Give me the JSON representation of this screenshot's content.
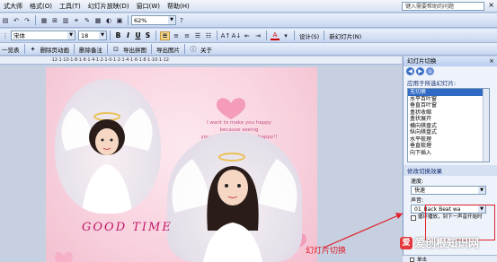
{
  "menubar": {
    "items": [
      "式大师",
      "格式(O)",
      "工具(T)",
      "幻灯片放映(D)",
      "窗口(W)",
      "帮助(H)"
    ],
    "help_placeholder": "键入需要帮助的问题"
  },
  "toolbar1": {
    "zoom_value": "62%"
  },
  "toolbar2": {
    "font_name": "宋体",
    "font_size": "18",
    "bold": "B",
    "italic": "I",
    "underline": "U",
    "shadow": "S",
    "design_label": "设计(S)",
    "new_slide_label": "新幻灯片(N)"
  },
  "toolbar3": {
    "items": [
      "一览表",
      "删除页动画",
      "删除备注",
      "导出拼图",
      "导出图片",
      "关于"
    ]
  },
  "ruler": {
    "text": "·12·1·10·1·8·1·6·1·4·1·2·1·0·1·2·1·4·1·6·1·8·1·10·1·12·"
  },
  "slide": {
    "poem_lines": [
      "I want to make you happy",
      "because seeing",
      "you smiling makes me happy!!"
    ],
    "brand_text": "GOOD TIME"
  },
  "task_pane": {
    "title": "幻灯片切换",
    "apply_label": "应用于所选幻灯片:",
    "transitions": [
      "无切换",
      "水平百叶窗",
      "垂直百叶窗",
      "盒状收缩",
      "盒状展开",
      "横向棋盘式",
      "纵向棋盘式",
      "水平梳理",
      "垂直梳理",
      "向下插入"
    ],
    "selected_transition_index": 0,
    "modify_label": "修改切换效果",
    "speed_label": "速度:",
    "speed_value": "快速",
    "sound_label": "声音:",
    "sound_value": "01_Back Beat wa",
    "loop_label": "循环播放，到下一声音开始时",
    "bottom_label": "单击"
  },
  "annotation": {
    "label": "幻灯片切换"
  },
  "watermark": {
    "logo": "爱",
    "text": "爱创根知识网"
  },
  "colors": {
    "accent_red": "#e0202a",
    "selection_blue": "#316ac5",
    "brand_pink": "#c2186a"
  }
}
